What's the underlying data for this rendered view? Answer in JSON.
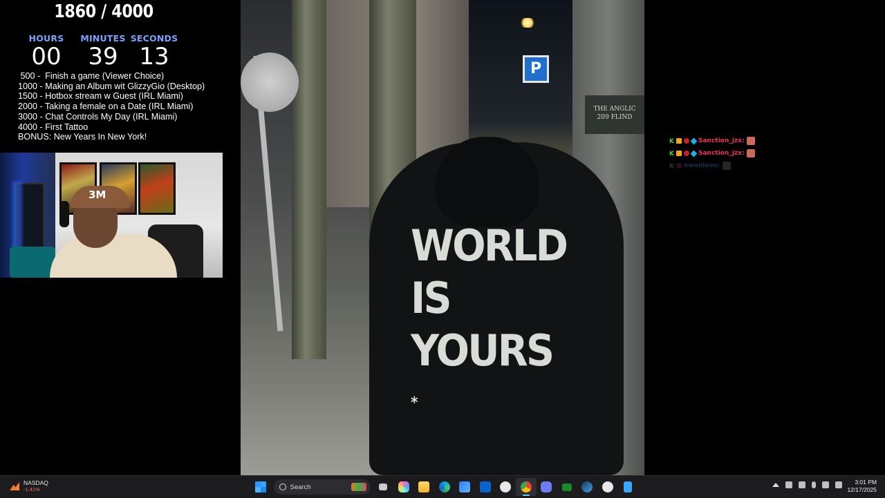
{
  "goal": {
    "text": "1860 / 4000"
  },
  "timer": {
    "hours_label": "HOURS",
    "minutes_label": "MINUTES",
    "seconds_label": "SECONDS",
    "hours": "00",
    "minutes": "39",
    "seconds": "13"
  },
  "goals_list": [
    " 500 -  Finish a game (Viewer Choice)",
    "1000 - Making an Album wit GlizzyGio (Desktop)",
    "1500 - Hotbox stream w Guest (IRL Miami)",
    "2000 - Taking a female on a Date (IRL Miami)",
    "3000 - Chat Controls My Day (IRL Miami)",
    "4000 - First Tattoo",
    "BONUS: New Years In New York!"
  ],
  "video": {
    "hoodie_lines": [
      "WORLD",
      "IS",
      "YOURS"
    ],
    "hoodie_mark": "*",
    "parking_sign": "P",
    "building_sign_1": "THE ANGLIC",
    "building_sign_2": "209 FLIND"
  },
  "webcam": {
    "cap_logo": "3M"
  },
  "chat": [
    {
      "badge_k": "K",
      "name": "Sanction_jzx:",
      "dim": false
    },
    {
      "badge_k": "K",
      "name": "Sanction_jzx:",
      "dim": false
    },
    {
      "badge_k": "K",
      "name": "nwonlooo:",
      "dim": true
    }
  ],
  "taskbar": {
    "stock_name": "NASDAQ",
    "stock_change": "-1.41%",
    "search_label": "Search",
    "time": "3:01 PM",
    "date": "12/17/2025",
    "colors": {
      "accent": "#60cdff",
      "bar": "#1c1c1f"
    }
  }
}
